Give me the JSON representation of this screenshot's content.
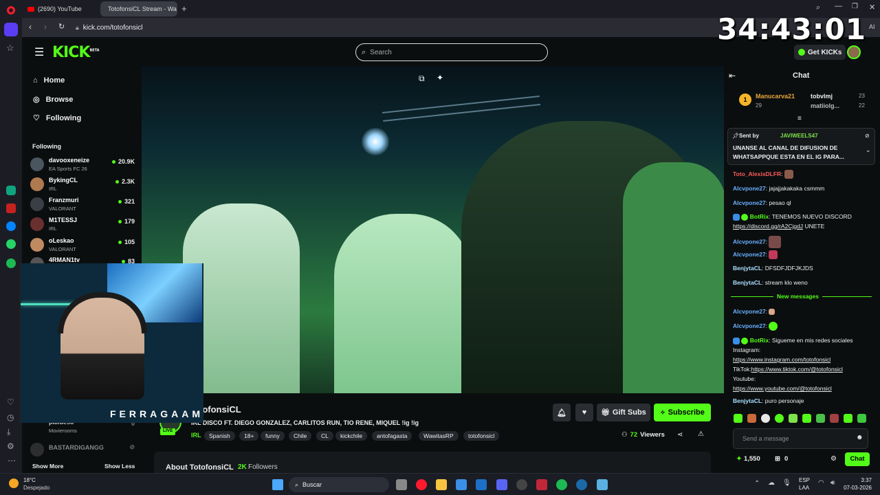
{
  "browser": {
    "tabs": [
      {
        "label": "(2690) YouTube"
      },
      {
        "label": "TotofonsiCL Stream - Wa"
      }
    ],
    "url": "kick.com/totofonsicl",
    "ai_label": "AI"
  },
  "overlay": {
    "timer": "34:43:01",
    "webcam_name": "FERRAGAAMO"
  },
  "header": {
    "logo": "KICK",
    "logo_badge": "BETA",
    "search_placeholder": "Search",
    "get_kicks_label": "Get KICKs"
  },
  "sidebar": {
    "nav": [
      {
        "label": "Home",
        "icon": "home-icon"
      },
      {
        "label": "Browse",
        "icon": "compass-icon"
      },
      {
        "label": "Following",
        "icon": "heart-icon"
      }
    ],
    "following_title": "Following",
    "following": [
      {
        "name": "davooxeneize",
        "category": "EA Sports FC 26",
        "viewers": "20.9K",
        "color": "#4a5560"
      },
      {
        "name": "BykingCL",
        "category": "IRL",
        "viewers": "2.3K",
        "color": "#b07a50"
      },
      {
        "name": "Franzmuri",
        "category": "VALORANT",
        "viewers": "321",
        "color": "#3a3f45"
      },
      {
        "name": "M1TESSJ",
        "category": "IRL",
        "viewers": "179",
        "color": "#6a3030"
      },
      {
        "name": "oLeskao",
        "category": "VALORANT",
        "viewers": "105",
        "color": "#c08a60"
      },
      {
        "name": "4RMAN1tv",
        "category": "",
        "viewers": "83",
        "color": "#555"
      }
    ],
    "offline": [
      {
        "name": "paiiueso",
        "category": "Movierooms",
        "viewers": "0"
      },
      {
        "name": "BASTARDIGANGG",
        "category": "",
        "viewers": ""
      }
    ],
    "show_more": "Show More",
    "show_less": "Show Less"
  },
  "stream": {
    "channel": "TotofonsiCL",
    "channel_display": "tofonsiCL",
    "live_badge": "LIVE",
    "title": "IRL DISCO FT. DIEGO GONZALEZ, CARLITOS RUN, TIO RENE, MIQUEL  !ig !ig",
    "category": "IRL",
    "tags": [
      "Spanish",
      "18+",
      "funny",
      "Chile",
      "CL",
      "kickchile",
      "antofagasta",
      "WawitasRP",
      "totofonsicl"
    ],
    "viewers": "72",
    "viewers_label": "Viewers",
    "gift_subs": "Gift Subs",
    "subscribe": "Subscribe",
    "about_title": "About TotofonsiCL",
    "followers_count": "2K",
    "followers_label": "Followers"
  },
  "chat": {
    "title": "Chat",
    "leaderboard": [
      {
        "rank": "1",
        "name": "Manucarva21",
        "points": "29"
      },
      {
        "name": "tobvlmj",
        "points": "23"
      },
      {
        "name": "matiiolg...",
        "points": "22"
      }
    ],
    "pinned": {
      "sent_by_label": "Sent by",
      "sender": "JAVIWEELS47",
      "text": "UNANSE AL CANAL DE DIFUSION DE WHATSAPPQUE ESTA EN EL IG PARA..."
    },
    "messages": [
      {
        "user": "Toto_AlexisDLFR",
        "text": "",
        "color": "#ff5b5b"
      },
      {
        "user": "Alcvpone27",
        "text": "jajajjakakaka csmmm",
        "color": "#6ab0ff"
      },
      {
        "user": "Alcvpone27",
        "text": "pesao ql",
        "color": "#6ab0ff"
      },
      {
        "user": "BotRix",
        "text": "TENEMOS NUEVO DISCORD",
        "link": "https://discord.gg/rA2CjgdJ",
        "after": "UNETE",
        "color": "#53fc18"
      },
      {
        "user": "Alcvpone27",
        "text": "",
        "color": "#6ab0ff"
      },
      {
        "user": "Alcvpone27",
        "text": "",
        "color": "#6ab0ff"
      },
      {
        "user": "BenjytaCL",
        "text": "DFSDFJDFJKJDS",
        "color": "#a8e0ff"
      },
      {
        "user": "BenjytaCL",
        "text": "stream klo weno",
        "color": "#a8e0ff"
      }
    ],
    "new_messages_label": "New messages",
    "messages_after": [
      {
        "user": "Alcvpone27",
        "text": "",
        "color": "#6ab0ff"
      },
      {
        "user": "Alcvpone27",
        "text": "",
        "color": "#6ab0ff"
      }
    ],
    "botrix_social": {
      "user": "BotRix",
      "text": "Sigueme en mis redes sociales",
      "ig_label": "Instagram:",
      "ig_link": "https://www.instagram.com/totofonsicl",
      "tiktok_label": "TikTok:",
      "tiktok_link": "https://www.tiktok.com/@totofonsicl",
      "yt_label": "Youtube:",
      "yt_link": "https://www.youtube.com/@totofonsicl"
    },
    "last_message": {
      "user": "BenjytaCL",
      "text": "puro personaje"
    },
    "input_placeholder": "Send a message",
    "kicks_balance": "1,550",
    "gift_count": "0",
    "chat_button": "Chat"
  },
  "taskbar": {
    "weather_temp": "18°C",
    "weather_desc": "Despejado",
    "search_label": "Buscar",
    "lang": "ESP",
    "lang_sub": "LAA",
    "time": "3:37",
    "date": "07-03-2026"
  },
  "colors": {
    "kick_green": "#53fc18",
    "bg": "#0b0e0f",
    "chip": "#24272c"
  }
}
